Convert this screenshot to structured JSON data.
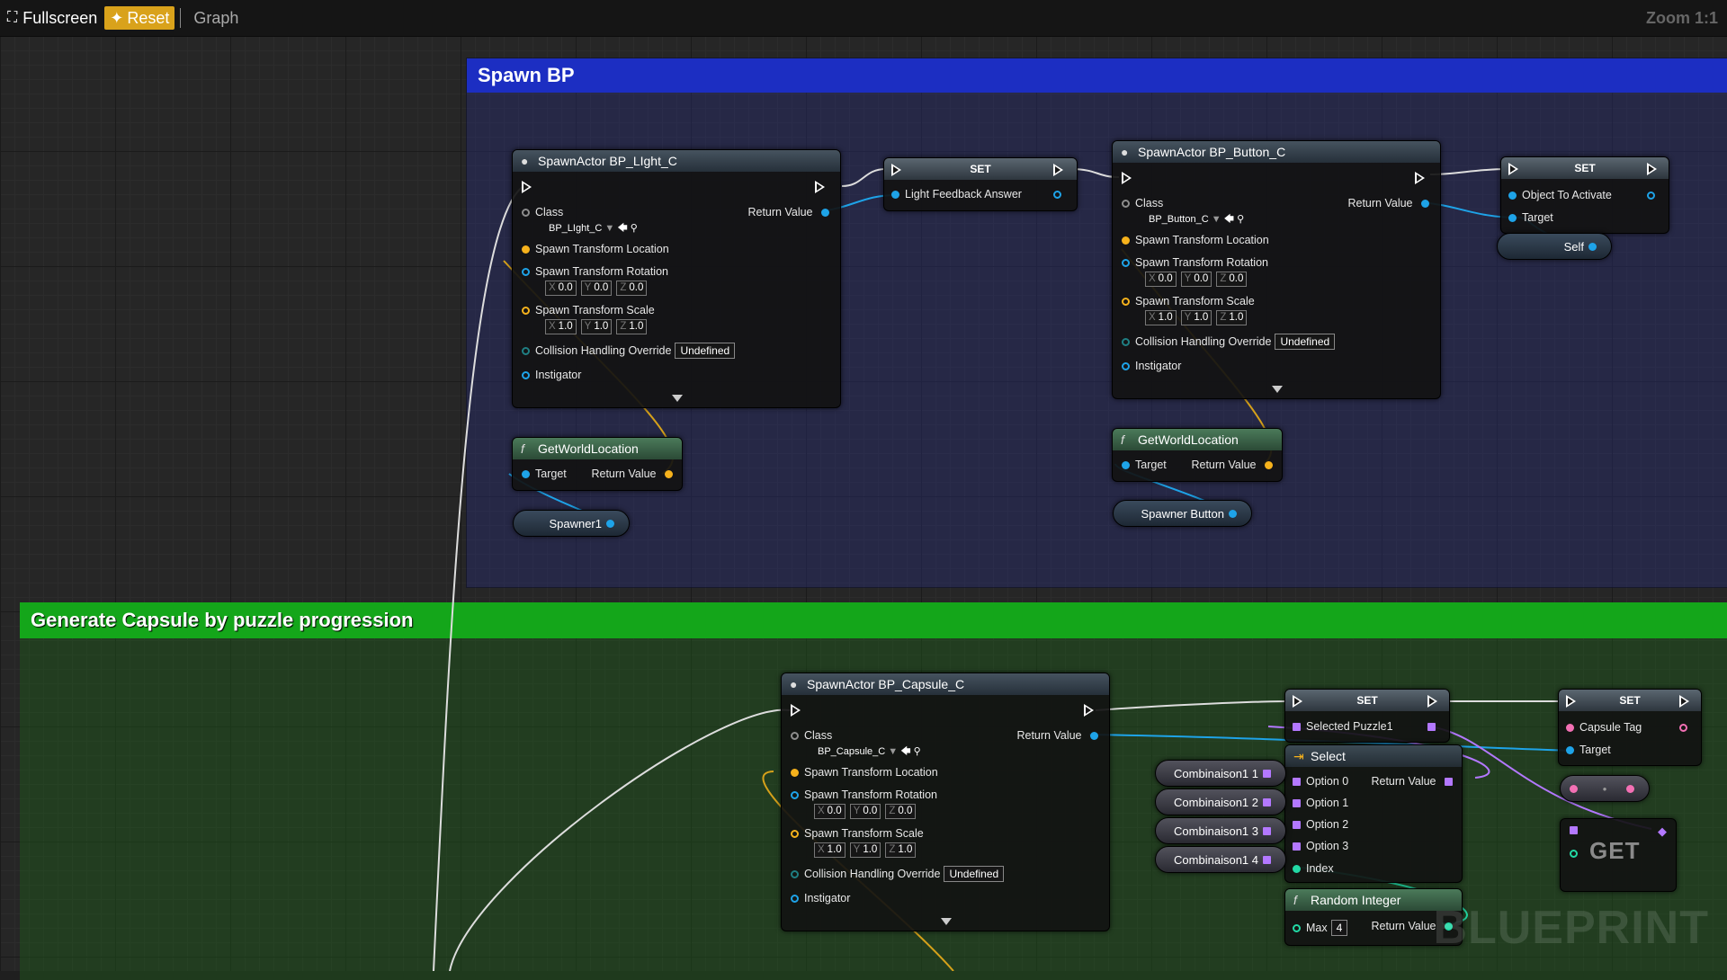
{
  "toolbar": {
    "fullscreen_label": "Fullscreen",
    "reset_label": "Reset",
    "graph_label": "Graph",
    "zoom_label": "Zoom 1:1"
  },
  "comments": {
    "spawn": "Spawn BP",
    "capsule": "Generate Capsule by puzzle progression"
  },
  "common": {
    "class": "Class",
    "return_value": "Return Value",
    "spawn_transform_location": "Spawn Transform Location",
    "spawn_transform_rotation": "Spawn Transform Rotation",
    "spawn_transform_scale": "Spawn Transform Scale",
    "collision_handling_override": "Collision Handling Override",
    "undefined": "Undefined",
    "instigator": "Instigator",
    "target": "Target",
    "x": "X",
    "y": "Y",
    "z": "Z",
    "rot_val": "0.0",
    "scale_val": "1.0"
  },
  "nodes": {
    "spawn_light": {
      "title": "SpawnActor BP_LIght_C",
      "class_value": "BP_LIght_C"
    },
    "set_light": {
      "title": "SET",
      "var": "Light Feedback Answer"
    },
    "spawn_button": {
      "title": "SpawnActor BP_Button_C",
      "class_value": "BP_Button_C"
    },
    "set_object": {
      "title": "SET",
      "var": "Object To Activate",
      "target": "Target"
    },
    "self": {
      "label": "Self"
    },
    "gwl1": {
      "title": "GetWorldLocation"
    },
    "spawner1": {
      "label": "Spawner1"
    },
    "gwl2": {
      "title": "GetWorldLocation"
    },
    "spawner_button": {
      "label": "Spawner Button"
    },
    "spawn_capsule": {
      "title": "SpawnActor BP_Capsule_C",
      "class_value": "BP_Capsule_C"
    },
    "set_puzzle": {
      "title": "SET",
      "var": "Selected Puzzle1"
    },
    "set_tag": {
      "title": "SET",
      "var": "Capsule Tag",
      "target": "Target"
    },
    "select": {
      "title": "Select",
      "options": [
        "Option 0",
        "Option 1",
        "Option 2",
        "Option 3"
      ],
      "index": "Index",
      "return": "Return Value"
    },
    "combis": [
      "Combinaison1 1",
      "Combinaison1 2",
      "Combinaison1 3",
      "Combinaison1 4"
    ],
    "random": {
      "title": "Random Integer",
      "max_label": "Max",
      "max_value": "4",
      "return": "Return Value"
    },
    "get": {
      "label": "GET"
    }
  },
  "watermark": "BLUEPRINT"
}
